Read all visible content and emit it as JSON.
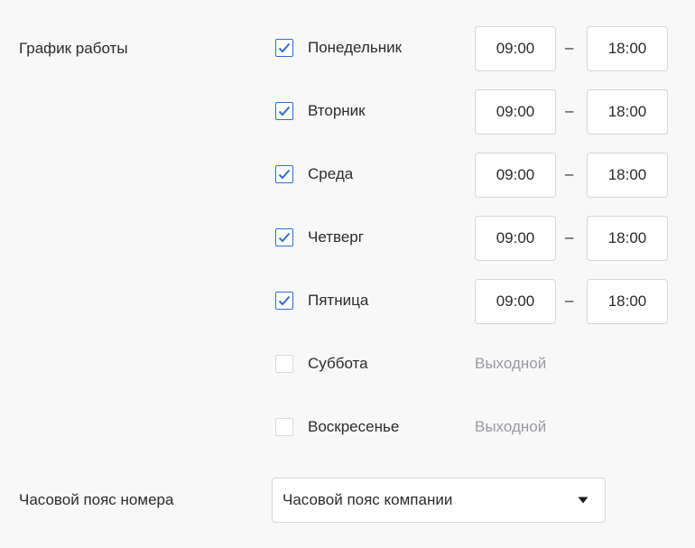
{
  "schedule": {
    "label": "График работы",
    "dash": "–",
    "days": [
      {
        "name": "Понедельник",
        "checked": true,
        "from": "09:00",
        "to": "18:00"
      },
      {
        "name": "Вторник",
        "checked": true,
        "from": "09:00",
        "to": "18:00"
      },
      {
        "name": "Среда",
        "checked": true,
        "from": "09:00",
        "to": "18:00"
      },
      {
        "name": "Четверг",
        "checked": true,
        "from": "09:00",
        "to": "18:00"
      },
      {
        "name": "Пятница",
        "checked": true,
        "from": "09:00",
        "to": "18:00"
      },
      {
        "name": "Суббота",
        "checked": false,
        "off_label": "Выходной"
      },
      {
        "name": "Воскресенье",
        "checked": false,
        "off_label": "Выходной"
      }
    ]
  },
  "timezone": {
    "label": "Часовой пояс номера",
    "selected": "Часовой пояс компании"
  },
  "colors": {
    "accent": "#2f6fd1",
    "text": "#2b2b2b",
    "muted": "#9a9aa0",
    "background": "#f8f8f9"
  }
}
